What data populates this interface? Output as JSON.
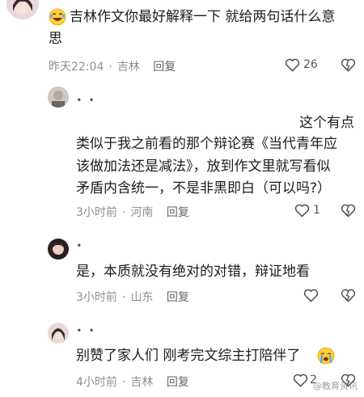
{
  "comments": [
    {
      "text_line1": "吉林作文你最好解释一下 就给两句话什么意",
      "text_line2": "思",
      "time": "昨天22:04",
      "location": "吉林",
      "reply_label": "回复",
      "likes": "26"
    },
    {
      "username": "∙ ∙",
      "text_line1": "这个有点",
      "text_line2": "类似于我之前看的那个辩论赛《当代青年应",
      "text_line3": "该做加法还是减法》，放到作文里就写看似",
      "text_line4": "矛盾内含统一，不是非黑即白（可以吗?）",
      "time": "3小时前",
      "location": "河南",
      "reply_label": "回复",
      "likes": "1"
    },
    {
      "username": "∙",
      "text_line1": "是，本质就没有绝对的对错，辩证地看",
      "time": "3小时前",
      "location": "山东",
      "reply_label": "回复",
      "likes": ""
    },
    {
      "username": "∙ ∙",
      "text_line1": "别赞了家人们 刚考完文综主打陪伴了",
      "time": "4小时前",
      "location": "吉林",
      "reply_label": "回复",
      "likes": "2"
    }
  ],
  "watermark": "@教育资讯"
}
